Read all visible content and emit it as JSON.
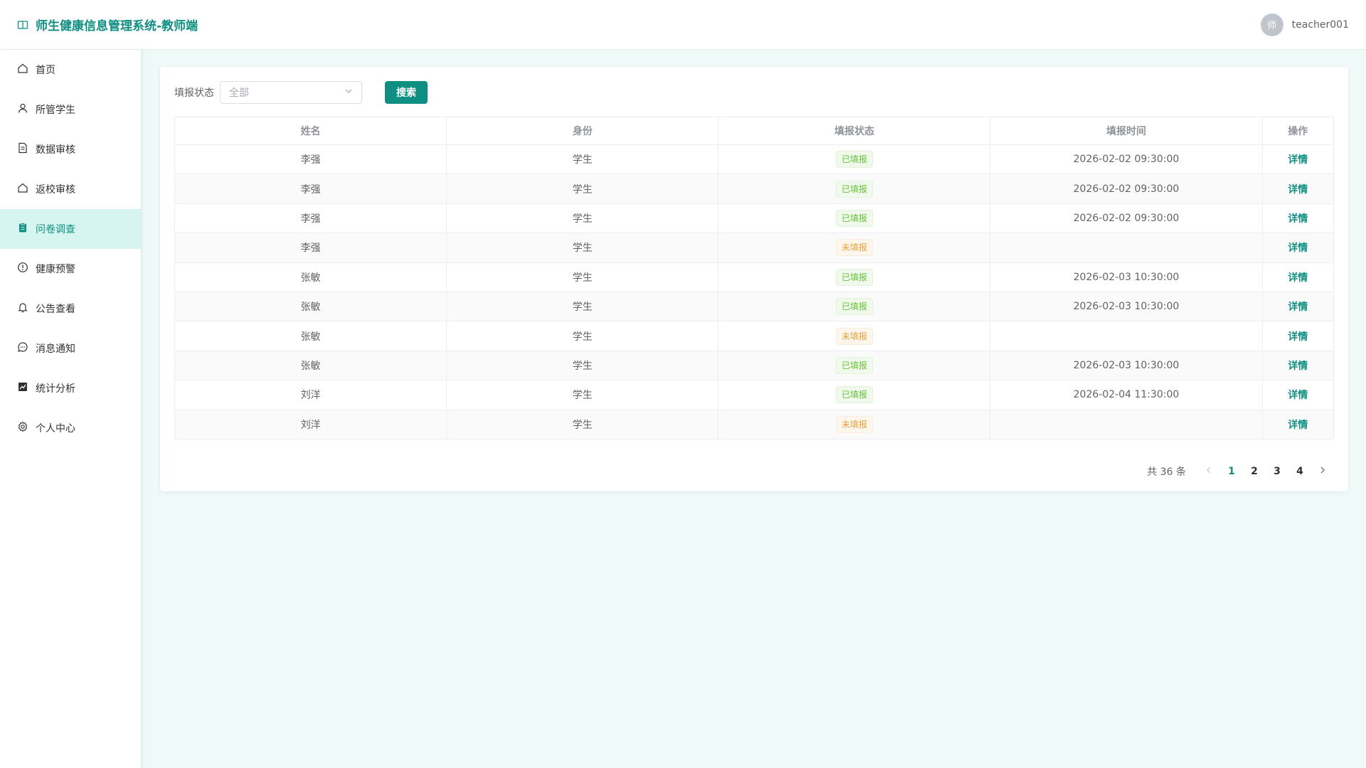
{
  "header": {
    "title": "师生健康信息管理系统-教师端",
    "avatar_text": "师",
    "username": "teacher001"
  },
  "sidebar": {
    "items": [
      {
        "label": "首页",
        "icon": "home-icon"
      },
      {
        "label": "所管学生",
        "icon": "user-icon"
      },
      {
        "label": "数据审核",
        "icon": "document-icon"
      },
      {
        "label": "返校审核",
        "icon": "house-icon"
      },
      {
        "label": "问卷调查",
        "icon": "clipboard-icon",
        "active": true
      },
      {
        "label": "健康预警",
        "icon": "warning-icon"
      },
      {
        "label": "公告查看",
        "icon": "bell-icon"
      },
      {
        "label": "消息通知",
        "icon": "chat-icon"
      },
      {
        "label": "统计分析",
        "icon": "chart-icon"
      },
      {
        "label": "个人中心",
        "icon": "gear-icon"
      }
    ]
  },
  "filter": {
    "label": "填报状态",
    "select_value": "全部",
    "search_button": "搜索"
  },
  "table": {
    "headers": [
      "姓名",
      "身份",
      "填报状态",
      "填报时间",
      "操作"
    ],
    "rows": [
      {
        "name": "李强",
        "role": "学生",
        "status": "已填报",
        "time": "2026-02-02 09:30:00",
        "action": "详情"
      },
      {
        "name": "李强",
        "role": "学生",
        "status": "已填报",
        "time": "2026-02-02 09:30:00",
        "action": "详情"
      },
      {
        "name": "李强",
        "role": "学生",
        "status": "已填报",
        "time": "2026-02-02 09:30:00",
        "action": "详情"
      },
      {
        "name": "李强",
        "role": "学生",
        "status": "未填报",
        "time": "",
        "action": "详情"
      },
      {
        "name": "张敏",
        "role": "学生",
        "status": "已填报",
        "time": "2026-02-03 10:30:00",
        "action": "详情"
      },
      {
        "name": "张敏",
        "role": "学生",
        "status": "已填报",
        "time": "2026-02-03 10:30:00",
        "action": "详情"
      },
      {
        "name": "张敏",
        "role": "学生",
        "status": "未填报",
        "time": "",
        "action": "详情"
      },
      {
        "name": "张敏",
        "role": "学生",
        "status": "已填报",
        "time": "2026-02-03 10:30:00",
        "action": "详情"
      },
      {
        "name": "刘洋",
        "role": "学生",
        "status": "已填报",
        "time": "2026-02-04 11:30:00",
        "action": "详情"
      },
      {
        "name": "刘洋",
        "role": "学生",
        "status": "未填报",
        "time": "",
        "action": "详情"
      }
    ]
  },
  "pagination": {
    "total_text": "共 36 条",
    "pages": [
      "1",
      "2",
      "3",
      "4"
    ],
    "current": "1"
  },
  "colors": {
    "accent": "#0f8f82",
    "active_menu_bg": "#d6f5f0",
    "page_bg": "#eff9f8"
  }
}
